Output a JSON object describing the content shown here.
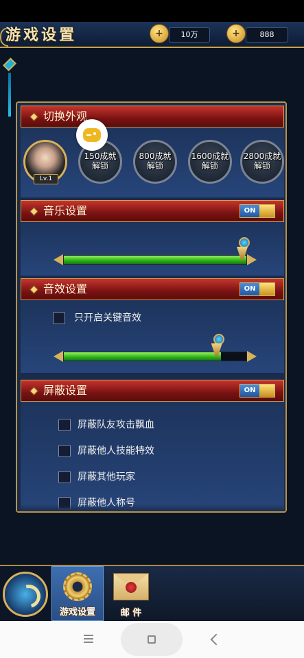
{
  "header": {
    "title": "游戏设置",
    "currency_1": {
      "icon": "gold-coin-plus-icon",
      "value": "10万"
    },
    "currency_2": {
      "icon": "ingot-plus-icon",
      "value": "888"
    }
  },
  "appearance": {
    "title": "切换外观",
    "current_level": "Lv.1",
    "locked": [
      {
        "line1": "150成就",
        "line2": "解锁"
      },
      {
        "line1": "800成就",
        "line2": "解锁"
      },
      {
        "line1": "1600成就",
        "line2": "解锁"
      },
      {
        "line1": "2800成就",
        "line2": "解锁"
      }
    ]
  },
  "music": {
    "title": "音乐设置",
    "toggle": "ON",
    "volume_percent": 100
  },
  "sfx": {
    "title": "音效设置",
    "toggle": "ON",
    "key_only_label": "只开启关键音效",
    "volume_percent": 86
  },
  "shield": {
    "title": "屏蔽设置",
    "toggle": "ON",
    "options": [
      "屏蔽队友攻击飘血",
      "屏蔽他人技能特效",
      "屏蔽其他玩家",
      "屏蔽他人称号"
    ]
  },
  "bottom_nav": {
    "tabs": [
      {
        "label": "游戏设置",
        "active": true
      },
      {
        "label": "邮 件",
        "active": false
      }
    ]
  }
}
